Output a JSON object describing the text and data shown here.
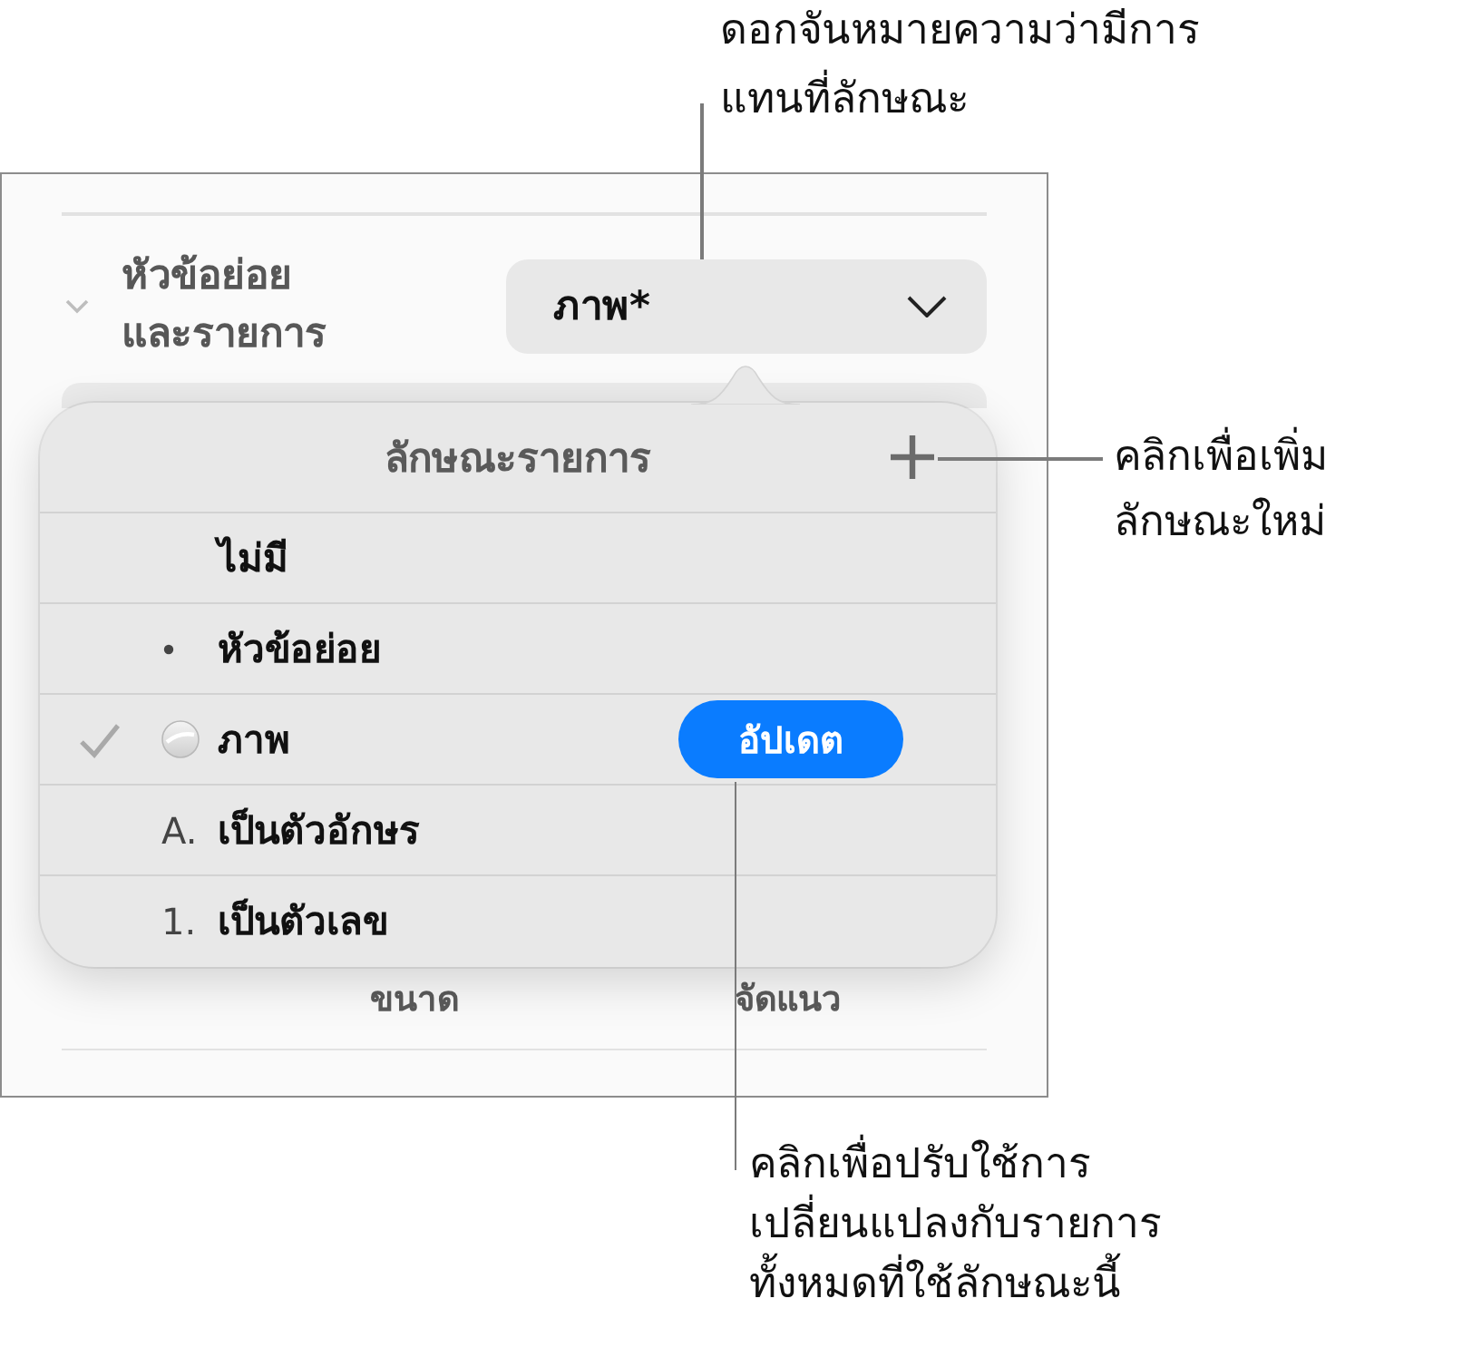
{
  "panel": {
    "section": {
      "title_lines": [
        "หัวข้อย่อย",
        "และรายการ"
      ],
      "expanded": true
    },
    "style_dropdown": {
      "value": "ภาพ*"
    },
    "footer_labels": [
      "ขนาด",
      "จัดแนว"
    ]
  },
  "popover": {
    "title": "ลักษณะรายการ",
    "items": [
      {
        "label": "ไม่มี",
        "kind": "none",
        "selected": false
      },
      {
        "label": "หัวข้อย่อย",
        "kind": "bullet",
        "selected": false
      },
      {
        "label": "ภาพ",
        "kind": "image",
        "selected": true,
        "button": "อัปเดต"
      },
      {
        "label": "เป็นตัวอักษร",
        "kind": "letter",
        "marker": "A.",
        "selected": false
      },
      {
        "label": "เป็นตัวเลข",
        "kind": "number",
        "marker": "1.",
        "selected": false
      }
    ]
  },
  "callouts": [
    {
      "lines": [
        "ดอกจันหมายความว่ามีการ",
        "แทนที่ลักษณะ"
      ]
    },
    {
      "lines": [
        "คลิกเพื่อเพิ่ม",
        "ลักษณะใหม่"
      ]
    },
    {
      "lines": [
        "คลิกเพื่อปรับใช้การ",
        "เปลี่ยนแปลงกับรายการ",
        "ทั้งหมดที่ใช้ลักษณะนี้"
      ]
    }
  ]
}
